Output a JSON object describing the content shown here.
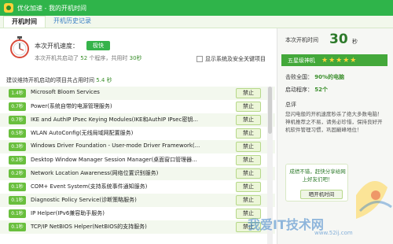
{
  "window": {
    "title": "优化加速 - 我的开机时间"
  },
  "tabs": [
    {
      "label": "开机时间",
      "active": true
    },
    {
      "label": "开机历史记录",
      "active": false
    }
  ],
  "speed": {
    "label": "本次开机速度：",
    "badge": "极快",
    "detail_prefix": "本次开机共启动了",
    "program_count": "52",
    "detail_mid": "个程序，共用时",
    "time_value": "30秒",
    "show_system_label": "显示系统及安全关键项目"
  },
  "list": {
    "header_prefix": "建议维持开机启动的项目共占用时间",
    "header_value": "5.4 秒",
    "ban_label": "禁止",
    "items": [
      {
        "time": "1.4秒",
        "name": "Microsoft Bloom Services"
      },
      {
        "time": "0.7秒",
        "name": "Power(系统自带的电源管理服务)"
      },
      {
        "time": "0.7秒",
        "name": "IKE and AuthIP IPsec Keying Modules(IKE和AuthIP IPsec密钥..."
      },
      {
        "time": "0.5秒",
        "name": "WLAN AutoConfig(无线局域网配置服务)"
      },
      {
        "time": "0.3秒",
        "name": "Windows Driver Foundation - User-mode Driver Framework(..."
      },
      {
        "time": "0.2秒",
        "name": "Desktop Window Manager Session Manager(桌面窗口管理器..."
      },
      {
        "time": "0.2秒",
        "name": "Network Location Awareness(网络位置识别服务)"
      },
      {
        "time": "0.1秒",
        "name": "COM+ Event System(支持系统事件通知服务)"
      },
      {
        "time": "0.1秒",
        "name": "Diagnostic Policy Service(诊断策略服务)"
      },
      {
        "time": "0.1秒",
        "name": "IP Helper(IPv6兼容助手服务)"
      },
      {
        "time": "0.1秒",
        "name": "TCP/IP NetBIOS Helper(NetBIOS的支持服务)"
      }
    ]
  },
  "summary": {
    "boot_time_label": "本次开机时间",
    "boot_time_value": "30",
    "boot_time_unit": "秒",
    "rating_label": "五星级神机",
    "stars": "★★★★★",
    "beat_label": "击败全国：",
    "beat_value": "90%的电脑",
    "startup_label": "启动程序：",
    "startup_value": "52个",
    "title": "总评",
    "text": "您闪电般的开机速度秒杀了绝大多数电脑！神机推荐之不易，请务必珍惜，保持良好开机软件管理习惯，巩固巅峰地位！",
    "share_text": "成绩不错，赶快分享给网上好友们吧！",
    "share_button": "晒开机时间"
  },
  "watermark": {
    "text": "我爱IT技术网",
    "url": "www.52ij.com"
  },
  "colors": {
    "green": "#2fb44a",
    "badge_green": "#69bf3d",
    "accent_text": "#3b8f2c"
  }
}
